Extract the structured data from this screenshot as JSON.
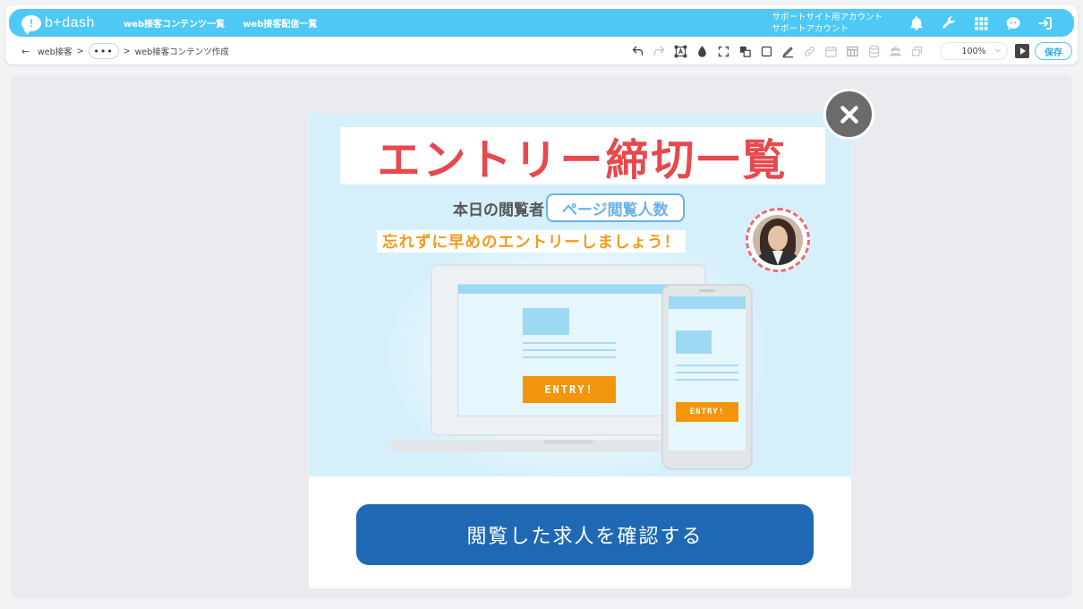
{
  "header": {
    "logo_text": "b+dash",
    "nav": [
      {
        "label": "web接客コンテンツ一覧"
      },
      {
        "label": "web接客配信一覧"
      }
    ],
    "account": {
      "line1": "サポートサイト用アカウント",
      "line2": "サポートアカウント"
    },
    "icons": [
      "bell-icon",
      "wrench-icon",
      "grid-icon",
      "chat-bot-icon",
      "logout-icon"
    ]
  },
  "breadcrumb": {
    "back_symbol": "←",
    "items": [
      "web接客",
      "•••",
      "web接客コンテンツ作成"
    ],
    "separator": ">"
  },
  "toolbar": {
    "zoom_value": "100%",
    "save_label": "保存",
    "icons": [
      "undo-icon",
      "redo-icon",
      "text-select-icon",
      "droplet-icon",
      "fullscreen-icon",
      "layers-icon",
      "square-icon",
      "pen-icon",
      "link-icon",
      "calendar-icon",
      "table-icon",
      "database-icon",
      "users-icon",
      "copy-icon"
    ]
  },
  "popup": {
    "title": "エントリー締切一覧",
    "viewer_label": "本日の閲覧者",
    "viewer_pill": "ページ閲覧人数",
    "reminder": "忘れずに早めのエントリーしましょう！",
    "laptop_entry": "ENTRY!",
    "phone_entry": "ENTRY!",
    "cta_label": "閲覧した求人を確認する"
  },
  "colors": {
    "brand": "#4ec9f5",
    "title_red": "#e7494e",
    "accent_orange": "#f39a1c",
    "cta_blue": "#1f68b4"
  }
}
